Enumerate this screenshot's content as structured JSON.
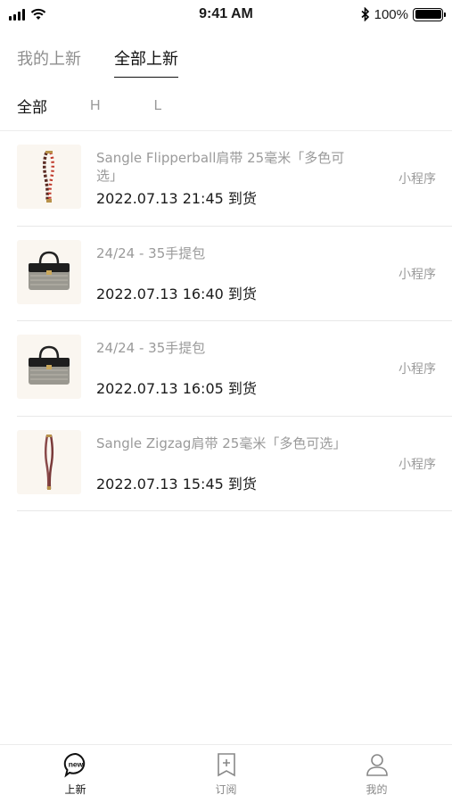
{
  "status_bar": {
    "time": "9:41 AM",
    "battery": "100%"
  },
  "top_tabs": [
    {
      "label": "我的上新",
      "active": false
    },
    {
      "label": "全部上新",
      "active": true
    }
  ],
  "filters": [
    {
      "label": "全部",
      "active": true
    },
    {
      "label": "H",
      "active": false
    },
    {
      "label": "L",
      "active": false
    }
  ],
  "items": [
    {
      "title": "Sangle Flipperball肩带 25毫米「多色可选」",
      "time": "2022.07.13 21:45 到货",
      "source": "小程序",
      "thumb": "strap-flipperball"
    },
    {
      "title": "24/24 - 35手提包",
      "time": "2022.07.13 16:40 到货",
      "source": "小程序",
      "thumb": "handbag"
    },
    {
      "title": "24/24 - 35手提包",
      "time": "2022.07.13 16:05 到货",
      "source": "小程序",
      "thumb": "handbag"
    },
    {
      "title": "Sangle Zigzag肩带 25毫米「多色可选」",
      "time": "2022.07.13 15:45 到货",
      "source": "小程序",
      "thumb": "strap-zigzag"
    }
  ],
  "bottom_nav": [
    {
      "label": "上新",
      "icon": "new-bubble-icon",
      "active": true
    },
    {
      "label": "订阅",
      "icon": "bookmark-plus-icon",
      "active": false
    },
    {
      "label": "我的",
      "icon": "person-icon",
      "active": false
    }
  ],
  "colors": {
    "text_primary": "#1a1a1a",
    "text_secondary": "#9a9a9a",
    "divider": "#e8e8e8",
    "thumb_bg": "#faf6f0"
  }
}
